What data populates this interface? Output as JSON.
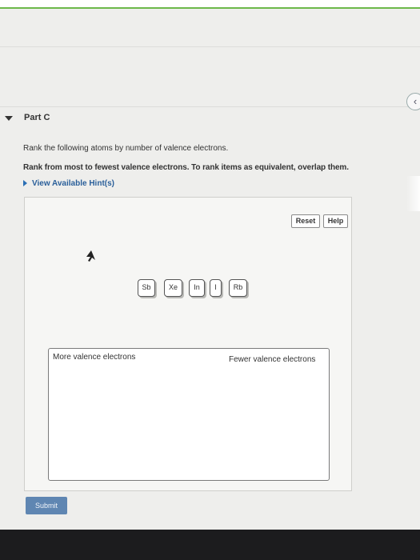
{
  "collapse_icon": "chevron-left-icon",
  "part": {
    "title": "Part C"
  },
  "question": {
    "instruction": "Rank the following atoms by number of valence electrons.",
    "rank_instruction": "Rank from most to fewest valence electrons. To rank items as equivalent, overlap them."
  },
  "hints": {
    "label": "View Available Hint(s)"
  },
  "toolbar": {
    "reset_label": "Reset",
    "help_label": "Help"
  },
  "items": [
    "Sb",
    "Xe",
    "In",
    "I",
    "Rb"
  ],
  "ranking": {
    "left_label": "More valence electrons",
    "right_label": "Fewer valence electrons"
  },
  "submit": {
    "label": "Submit"
  },
  "colors": {
    "accent_green": "#6db84a",
    "submit_blue": "#5f86b2",
    "hint_blue": "#2a5f9a"
  }
}
